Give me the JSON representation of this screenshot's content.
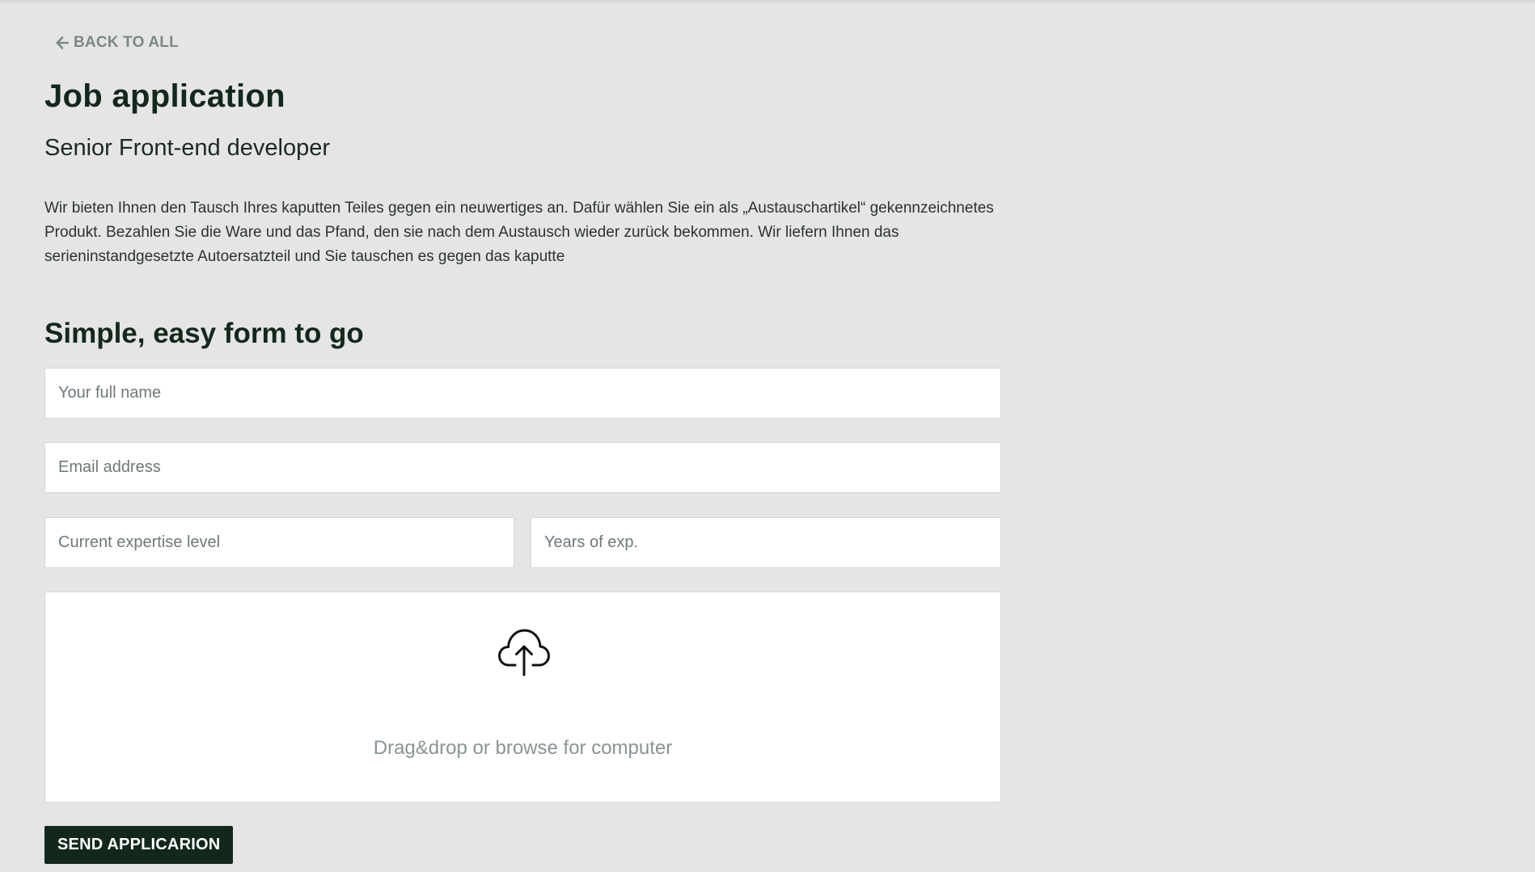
{
  "nav": {
    "back_label": "BACK TO ALL",
    "back_icon": "arrow-left-icon"
  },
  "header": {
    "title": "Job application",
    "subtitle": "Senior Front-end developer",
    "description": "Wir bieten Ihnen den Tausch Ihres kaputten Teiles gegen ein neuwertiges an. Dafür wählen Sie ein als „Austauschartikel“ gekennzeichnetes Produkt. Bezahlen Sie die Ware und das Pfand, den sie nach dem Austausch wieder zurück bekommen. Wir liefern Ihnen das serieninstandgesetzte Autoersatzteil und Sie tauschen es gegen das kaputte"
  },
  "form": {
    "title": "Simple, easy form to go",
    "full_name": {
      "placeholder": "Your full name",
      "value": ""
    },
    "email": {
      "placeholder": "Email address",
      "value": ""
    },
    "expertise": {
      "placeholder": "Current expertise level",
      "value": ""
    },
    "years": {
      "placeholder": "Years of exp.",
      "value": ""
    },
    "upload": {
      "icon": "cloud-upload-icon",
      "text": "Drag&drop or browse for computer"
    },
    "submit_label": "SEND APPLICARION"
  },
  "colors": {
    "background": "#e5e5e5",
    "primary": "#13281c",
    "muted": "#7a8a82"
  }
}
